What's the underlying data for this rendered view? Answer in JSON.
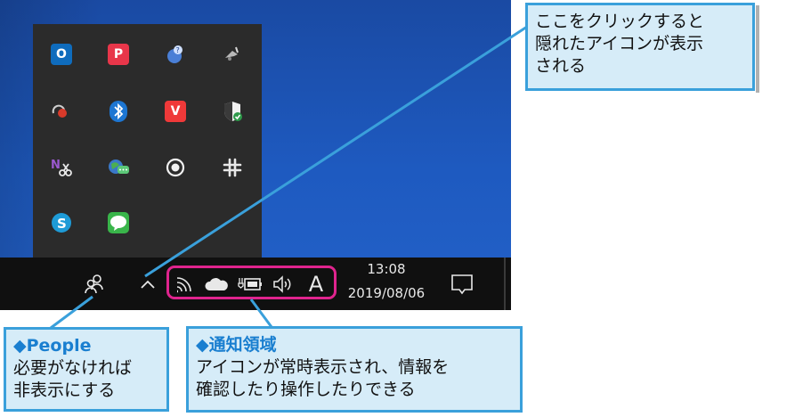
{
  "callouts": {
    "top": {
      "text_line1": "ここをクリックすると",
      "text_line2": "隠れたアイコンが表示",
      "text_line3": "される"
    },
    "people": {
      "title": "◆People",
      "text_line1": "必要がなければ",
      "text_line2": "非表示にする"
    },
    "notification_area": {
      "title": "◆通知領域",
      "text_line1": "アイコンが常時表示され、情報を",
      "text_line2": "確認したり操作したりできる"
    }
  },
  "taskbar": {
    "clock_time": "13:08",
    "clock_date": "2019/08/06",
    "ime_indicator": "A"
  },
  "hidden_icons": [
    {
      "icon": "outlook-icon",
      "glyph": "O",
      "color": "#0f6cbd"
    },
    {
      "icon": "pocket-icon",
      "glyph": "P",
      "color": "#e8364a"
    },
    {
      "icon": "network-globe-icon",
      "glyph": "?",
      "color": "#4a7fd6"
    },
    {
      "icon": "eject-usb-icon",
      "glyph": "⏏",
      "color": "#9a9a9a"
    },
    {
      "icon": "record-app-icon",
      "glyph": "●",
      "color": "#d83a2a"
    },
    {
      "icon": "bluetooth-icon",
      "glyph": "ᛒ",
      "color": "#1d76d2"
    },
    {
      "icon": "vivaldi-icon",
      "glyph": "V",
      "color": "#ef3939"
    },
    {
      "icon": "security-shield-icon",
      "glyph": "✓",
      "color": "#2e9a4a"
    },
    {
      "icon": "onenote-clip-icon",
      "glyph": "N",
      "color": "#7a3fa8"
    },
    {
      "icon": "chat-globe-icon",
      "glyph": "…",
      "color": "#3aa55d"
    },
    {
      "icon": "record-circle-icon",
      "glyph": "◉",
      "color": "#ffffff"
    },
    {
      "icon": "slack-icon",
      "glyph": "#",
      "color": "#e8e8e8"
    },
    {
      "icon": "skype-icon",
      "glyph": "S",
      "color": "#1e9bd7"
    },
    {
      "icon": "line-icon",
      "glyph": "…",
      "color": "#39b54a"
    }
  ],
  "colors": {
    "callout_border": "#3aa0db",
    "callout_fill": "#d6ecf8",
    "callout_title": "#1a7fd0",
    "highlight": "#e0248e",
    "taskbar": "#101010",
    "flyout": "#2b2b2b"
  }
}
